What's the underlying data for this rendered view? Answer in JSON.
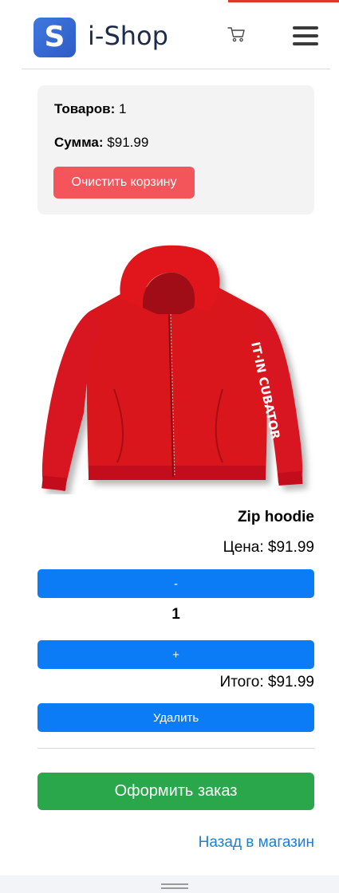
{
  "header": {
    "logo_letter": "S",
    "brand": "i-Shop",
    "cart_icon": "cart-icon",
    "menu_icon": "hamburger-menu-icon"
  },
  "summary": {
    "items_label": "Товаров:",
    "items_count": "1",
    "sum_label": "Сумма:",
    "sum_value": "$91.99",
    "clear_button": "Очистить корзину"
  },
  "product": {
    "name": "Zip hoodie",
    "price": "Цена: $91.99",
    "decrement_label": "-",
    "quantity": "1",
    "increment_label": "+",
    "total": "Итого: $91.99",
    "remove_button": "Удалить",
    "image_sleeve_text": "IT·IN CUBATOR"
  },
  "actions": {
    "checkout_button": "Оформить заказ",
    "back_link": "Назад в магазин"
  },
  "colors": {
    "clear": "#f4555a",
    "primary": "#0b7cf6",
    "success": "#2aa74a",
    "link": "#1b7fd6",
    "hoodie": "#d9141f"
  }
}
